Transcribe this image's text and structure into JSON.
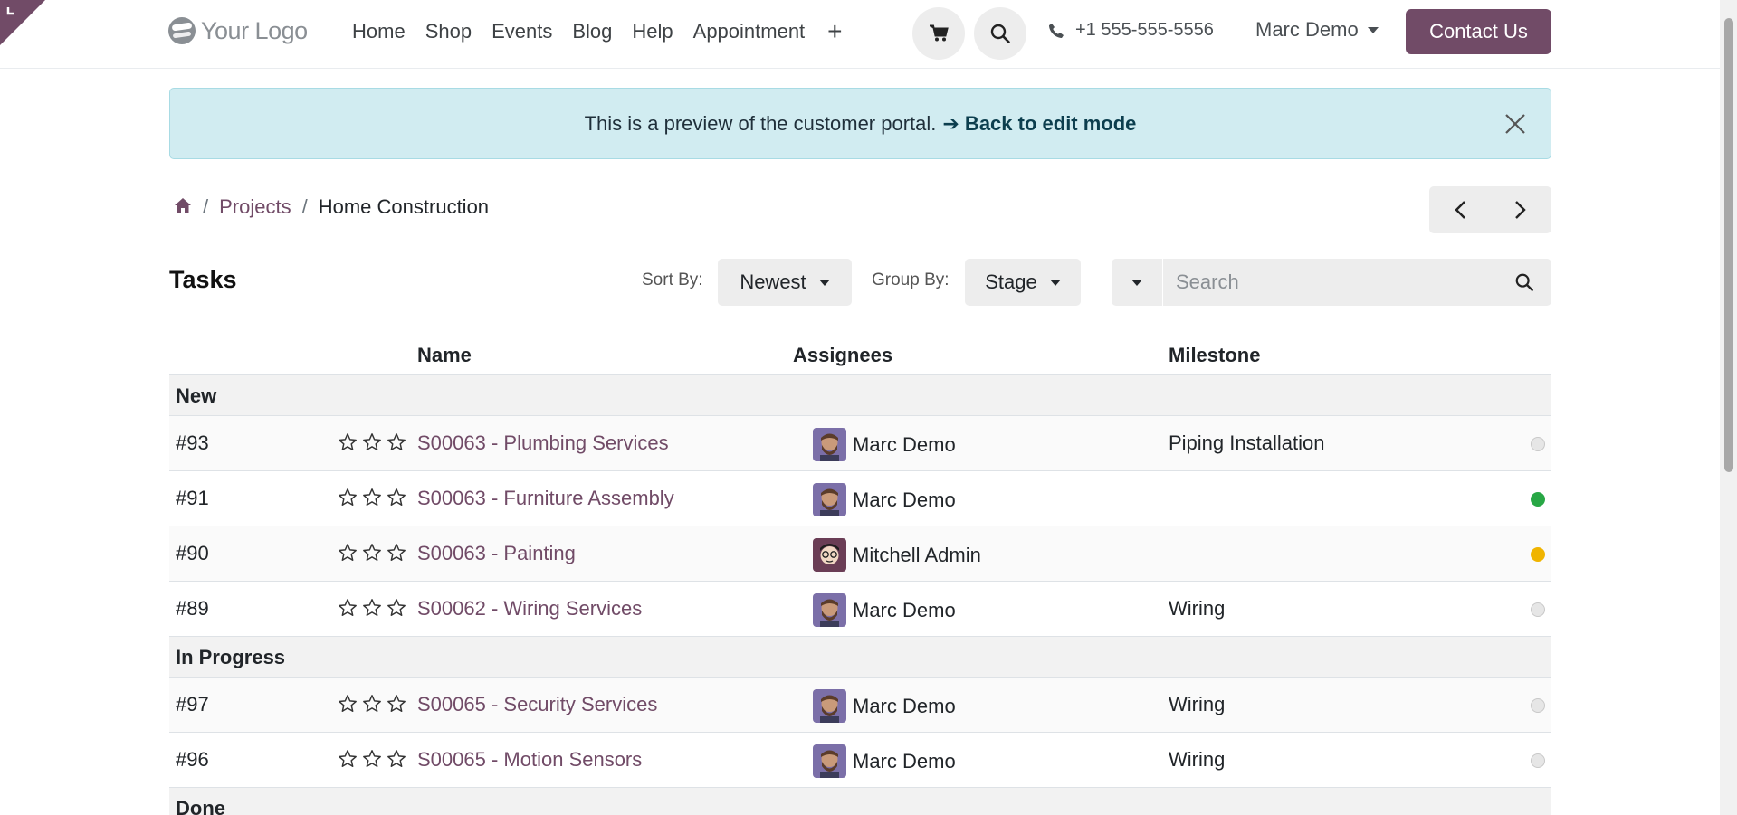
{
  "nav": {
    "logo_text": "Your Logo",
    "links": [
      "Home",
      "Shop",
      "Events",
      "Blog",
      "Help",
      "Appointment"
    ],
    "plus": "+",
    "phone": "+1 555-555-5556",
    "user": "Marc Demo",
    "contact_label": "Contact Us"
  },
  "alert": {
    "text": "This is a preview of the customer portal.",
    "link": "➔ Back to edit mode"
  },
  "breadcrumb": {
    "separator": "/",
    "projects": "Projects",
    "current": "Home Construction"
  },
  "toolbar": {
    "title": "Tasks",
    "sort_label": "Sort By:",
    "sort_value": "Newest",
    "group_label": "Group By:",
    "group_value": "Stage",
    "search_placeholder": "Search"
  },
  "table": {
    "headers": {
      "name": "Name",
      "assignees": "Assignees",
      "milestone": "Milestone"
    },
    "groups": [
      {
        "label": "New",
        "rows": [
          {
            "ref": "#93",
            "name": "S00063 - Plumbing Services",
            "assignee": "Marc Demo",
            "milestone": "Piping Installation",
            "state": "normal"
          },
          {
            "ref": "#91",
            "name": "S00063 - Furniture Assembly",
            "assignee": "Marc Demo",
            "milestone": "",
            "state": "done"
          },
          {
            "ref": "#90",
            "name": "S00063 - Painting",
            "assignee": "Mitchell Admin",
            "milestone": "",
            "state": "changes_requested"
          },
          {
            "ref": "#89",
            "name": "S00062 - Wiring Services",
            "assignee": "Marc Demo",
            "milestone": "Wiring",
            "state": "normal"
          }
        ]
      },
      {
        "label": "In Progress",
        "rows": [
          {
            "ref": "#97",
            "name": "S00065 - Security Services",
            "assignee": "Marc Demo",
            "milestone": "Wiring",
            "state": "normal"
          },
          {
            "ref": "#96",
            "name": "S00065 - Motion Sensors",
            "assignee": "Marc Demo",
            "milestone": "Wiring",
            "state": "normal"
          }
        ]
      },
      {
        "label": "Done",
        "rows": []
      }
    ]
  },
  "colors": {
    "brand": "#714b67",
    "alert_bg": "#d1ecf1",
    "state_normal": "#e6e6e6",
    "state_done": "#28a745",
    "state_changes": "#f0b400"
  }
}
